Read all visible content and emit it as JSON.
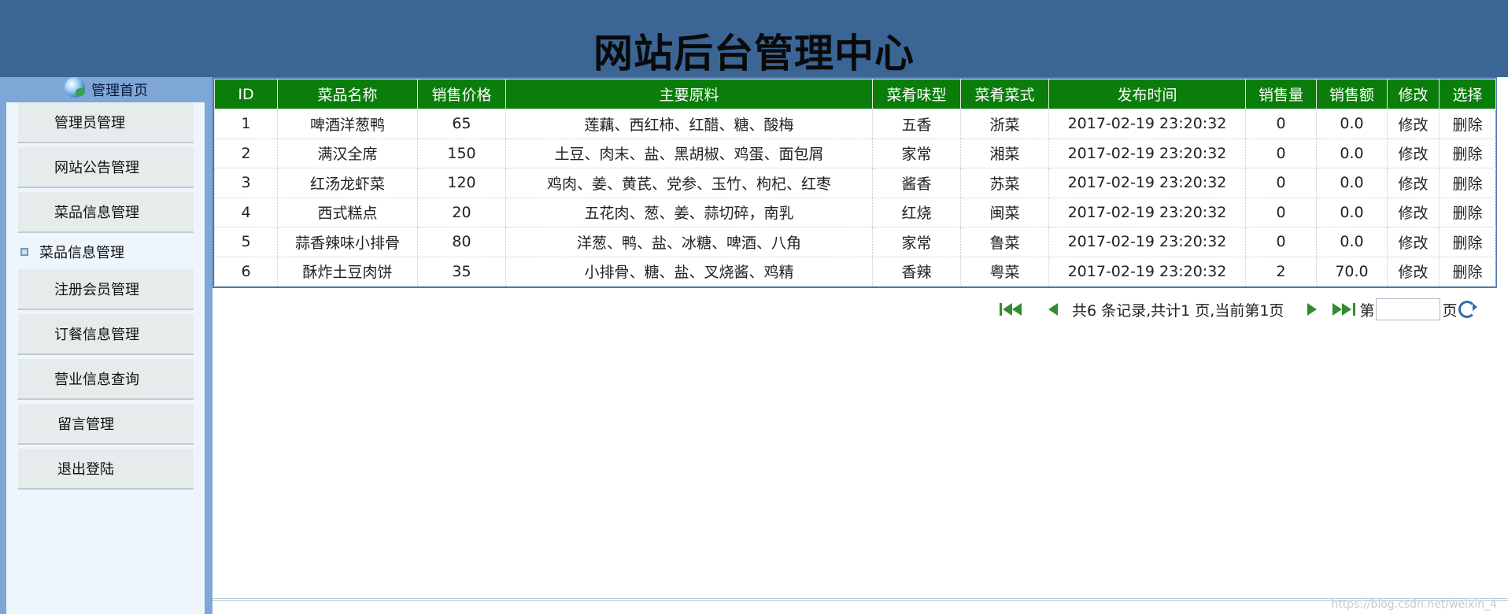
{
  "header": {
    "title": "网站后台管理中心"
  },
  "sidebar": {
    "home_label": "管理首页",
    "items": [
      {
        "label": "管理员管理"
      },
      {
        "label": "网站公告管理"
      },
      {
        "label": "菜品信息管理"
      },
      {
        "label": "菜品信息管理"
      },
      {
        "label": "注册会员管理"
      },
      {
        "label": "订餐信息管理"
      },
      {
        "label": "营业信息查询"
      },
      {
        "label": "留言管理"
      },
      {
        "label": "退出登陆"
      }
    ]
  },
  "table": {
    "columns": [
      "ID",
      "菜品名称",
      "销售价格",
      "主要原料",
      "菜肴味型",
      "菜肴菜式",
      "发布时间",
      "销售量",
      "销售额",
      "修改",
      "选择"
    ],
    "rows": [
      {
        "id": "1",
        "name": "啤酒洋葱鸭",
        "price": "65",
        "ingredients": "莲藕、西红柿、红醋、糖、酸梅",
        "flavor": "五香",
        "cuisine": "浙菜",
        "time": "2017-02-19 23:20:32",
        "qty": "0",
        "amount": "0.0",
        "edit": "修改",
        "delete": "删除"
      },
      {
        "id": "2",
        "name": "满汉全席",
        "price": "150",
        "ingredients": "土豆、肉末、盐、黑胡椒、鸡蛋、面包屑",
        "flavor": "家常",
        "cuisine": "湘菜",
        "time": "2017-02-19 23:20:32",
        "qty": "0",
        "amount": "0.0",
        "edit": "修改",
        "delete": "删除"
      },
      {
        "id": "3",
        "name": "红汤龙虾菜",
        "price": "120",
        "ingredients": "鸡肉、姜、黄芪、党参、玉竹、枸杞、红枣",
        "flavor": "酱香",
        "cuisine": "苏菜",
        "time": "2017-02-19 23:20:32",
        "qty": "0",
        "amount": "0.0",
        "edit": "修改",
        "delete": "删除"
      },
      {
        "id": "4",
        "name": "西式糕点",
        "price": "20",
        "ingredients": "五花肉、葱、姜、蒜切碎，南乳",
        "flavor": "红烧",
        "cuisine": "闽菜",
        "time": "2017-02-19 23:20:32",
        "qty": "0",
        "amount": "0.0",
        "edit": "修改",
        "delete": "删除"
      },
      {
        "id": "5",
        "name": "蒜香辣味小排骨",
        "price": "80",
        "ingredients": "洋葱、鸭、盐、冰糖、啤酒、八角",
        "flavor": "家常",
        "cuisine": "鲁菜",
        "time": "2017-02-19 23:20:32",
        "qty": "0",
        "amount": "0.0",
        "edit": "修改",
        "delete": "删除"
      },
      {
        "id": "6",
        "name": "酥炸土豆肉饼",
        "price": "35",
        "ingredients": "小排骨、糖、盐、叉烧酱、鸡精",
        "flavor": "香辣",
        "cuisine": "粤菜",
        "time": "2017-02-19 23:20:32",
        "qty": "2",
        "amount": "70.0",
        "edit": "修改",
        "delete": "删除"
      }
    ]
  },
  "pager": {
    "summary": "共6 条记录,共计1 页,当前第1页",
    "page_prefix": "第",
    "page_suffix": "页",
    "page_input_value": ""
  },
  "watermark": "https://blog.csdn.net/weixin_4"
}
